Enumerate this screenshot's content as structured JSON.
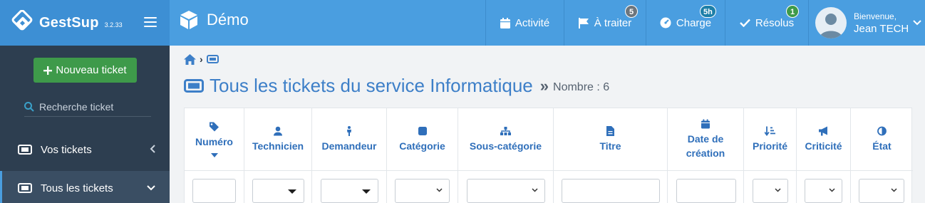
{
  "app": {
    "name": "GestSup",
    "version": "3.2.33"
  },
  "company": {
    "name": "Démo"
  },
  "nav": [
    {
      "label": "Activité",
      "icon": "calendar-icon"
    },
    {
      "label": "À traiter",
      "icon": "flag-icon",
      "badge": "5",
      "badge_color": "#6c757d"
    },
    {
      "label": "Charge",
      "icon": "gauge-icon",
      "badge": "5h",
      "badge_color": "#1d7fa8"
    },
    {
      "label": "Résolus",
      "icon": "check-icon",
      "badge": "1",
      "badge_color": "#3e9a4a"
    }
  ],
  "user": {
    "welcome": "Bienvenue,",
    "name": "Jean TECH"
  },
  "sidebar": {
    "new_ticket": "Nouveau ticket",
    "search_placeholder": "Recherche ticket",
    "items": [
      {
        "label": "Vos tickets"
      },
      {
        "label": "Tous les tickets"
      }
    ]
  },
  "page": {
    "title": "Tous les tickets du service Informatique",
    "count": "Nombre : 6"
  },
  "table": {
    "columns": [
      {
        "label": "Numéro",
        "icon": "tag-icon"
      },
      {
        "label": "Technicien",
        "icon": "user-icon"
      },
      {
        "label": "Demandeur",
        "icon": "person-icon"
      },
      {
        "label": "Catégorie",
        "icon": "square-icon"
      },
      {
        "label": "Sous-catégorie",
        "icon": "sitemap-icon"
      },
      {
        "label": "Titre",
        "icon": "file-icon"
      },
      {
        "label": "Date de création",
        "icon": "calendar-icon"
      },
      {
        "label": "Priorité",
        "icon": "sort-icon"
      },
      {
        "label": "Criticité",
        "icon": "bullhorn-icon"
      },
      {
        "label": "État",
        "icon": "adjust-icon"
      }
    ]
  },
  "colors": {
    "topbar": "#4a9ee0",
    "sidebar": "#2d3e50",
    "accent": "#3d7fc8",
    "success": "#3e9a4a"
  }
}
